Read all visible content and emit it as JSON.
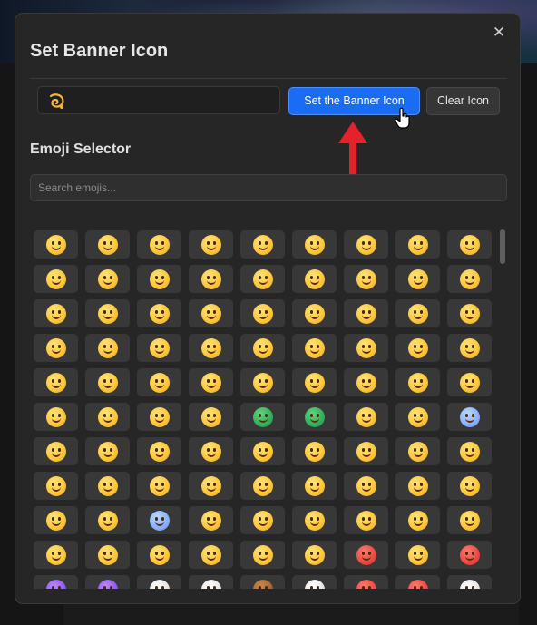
{
  "dialog": {
    "title": "Set Banner Icon",
    "close_label": "✕",
    "set_button": "Set the Banner Icon",
    "clear_button": "Clear Icon",
    "section_title": "Emoji Selector",
    "search_placeholder": "Search emojis...",
    "current_icon": "rolling-face-icon",
    "accent_color": "#1a6cf5",
    "arrow_color": "#e5212b"
  },
  "emoji_grid": [
    [
      "yellow",
      "yellow",
      "yellow",
      "yellow",
      "yellow",
      "yellow",
      "yellow",
      "yellow",
      "yellow"
    ],
    [
      "yellow",
      "yellow",
      "yellow",
      "yellow",
      "yellow",
      "yellow",
      "yellow",
      "yellow",
      "yellow"
    ],
    [
      "yellow",
      "yellow",
      "yellow",
      "yellow",
      "yellow",
      "yellow",
      "yellow",
      "yellow",
      "yellow"
    ],
    [
      "yellow",
      "yellow",
      "yellow",
      "yellow",
      "yellow",
      "yellow",
      "yellow",
      "yellow",
      "yellow"
    ],
    [
      "yellow",
      "yellow",
      "yellow",
      "yellow",
      "yellow",
      "yellow",
      "yellow",
      "yellow",
      "yellow"
    ],
    [
      "yellow",
      "yellow",
      "yellow",
      "yellow",
      "green",
      "green",
      "yellow",
      "yellow",
      "blue"
    ],
    [
      "yellow",
      "yellow",
      "yellow",
      "yellow",
      "yellow",
      "yellow",
      "yellow",
      "yellow",
      "yellow"
    ],
    [
      "yellow",
      "yellow",
      "yellow",
      "yellow",
      "yellow",
      "yellow",
      "yellow",
      "yellow",
      "yellow"
    ],
    [
      "yellow",
      "yellow",
      "blue",
      "yellow",
      "yellow",
      "yellow",
      "yellow",
      "yellow",
      "yellow"
    ],
    [
      "yellow",
      "yellow",
      "yellow",
      "yellow",
      "yellow",
      "yellow",
      "red",
      "yellow",
      "red"
    ],
    [
      "purple",
      "purple",
      "white",
      "white",
      "brown",
      "white",
      "red",
      "red",
      "white"
    ]
  ]
}
